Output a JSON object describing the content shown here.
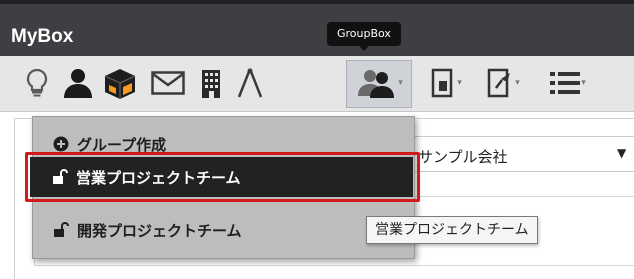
{
  "header": {
    "title": "MyBox"
  },
  "tooltip": {
    "text": "GroupBox"
  },
  "toolbar": {
    "icons": [
      "lightbulb-icon",
      "user-icon",
      "box-icon",
      "envelope-icon",
      "building-icon",
      "compass-icon",
      "group-icon",
      "document-icon",
      "document-pin-icon",
      "list-icon"
    ],
    "selected": "group-icon"
  },
  "select": {
    "value": "サンプル会社",
    "arrow": "▼"
  },
  "menu": {
    "add_label": "グループ作成",
    "items": [
      {
        "label": "営業プロジェクトチーム"
      },
      {
        "label": "開発プロジェクトチーム"
      }
    ]
  },
  "item_tooltip": {
    "text": "営業プロジェクトチーム"
  },
  "colors": {
    "header_bg": "#3d3f42",
    "highlight_frame": "#d11a1a",
    "selected_item_bg": "#222222",
    "menu_bg": "#bdbdbd"
  }
}
